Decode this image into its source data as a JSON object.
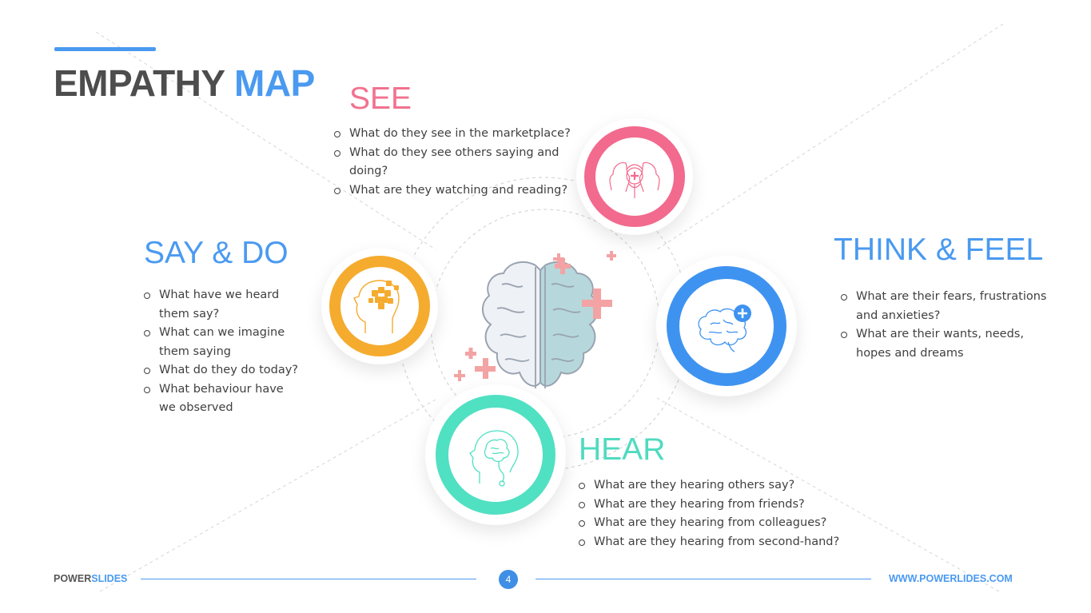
{
  "title": {
    "part1": "EMPATHY",
    "part2": "MAP"
  },
  "sections": {
    "see": {
      "title": "SEE",
      "items": [
        "What do they see in the marketplace?",
        "What do they see others saying and doing?",
        "What are they watching and reading?"
      ]
    },
    "say_do": {
      "title": "SAY & DO",
      "items": [
        "What have we heard them say?",
        "What can we imagine them saying",
        "What do they do today?",
        "What behaviour have we observed"
      ]
    },
    "think_feel": {
      "title": "THINK & FEEL",
      "items": [
        "What are their fears, frustrations and anxieties?",
        "What are their wants, needs, hopes and dreams"
      ]
    },
    "hear": {
      "title": "HEAR",
      "items": [
        "What are they hearing others say?",
        "What are they hearing from friends?",
        "What are they hearing from colleagues?",
        "What are they hearing from second-hand?"
      ]
    }
  },
  "icons": {
    "see": "head-brain-icon",
    "say_do": "head-puzzle-icon",
    "think_feel": "brain-plus-icon",
    "hear": "head-brain-icon",
    "center": "brain-icon"
  },
  "colors": {
    "see": "#f26a8d",
    "say_do": "#f5ab2e",
    "think_feel": "#3f93f0",
    "hear": "#50e0c2",
    "accent": "#4a9af0",
    "title_dark": "#4d4d4d"
  },
  "footer": {
    "brand_part1": "POWER",
    "brand_part2": "SLIDES",
    "page_number": "4",
    "url": "WWW.POWERLIDES.COM"
  }
}
